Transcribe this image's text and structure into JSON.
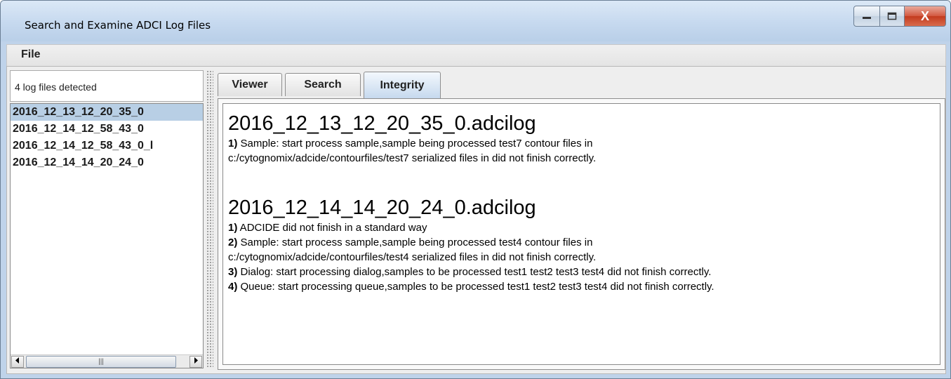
{
  "window": {
    "title": "Search and Examine ADCI Log Files",
    "close_symbol": "X"
  },
  "menubar": {
    "file_label": "File"
  },
  "sidebar": {
    "count_text": "4 log files detected",
    "files": [
      "2016_12_13_12_20_35_0",
      "2016_12_14_12_58_43_0",
      "2016_12_14_12_58_43_0_l",
      "2016_12_14_14_20_24_0"
    ],
    "selected_index": 0,
    "scroll_thumb_grip": "|||"
  },
  "tabs": [
    {
      "label": "Viewer"
    },
    {
      "label": "Search"
    },
    {
      "label": "Integrity"
    }
  ],
  "active_tab": "Integrity",
  "integrity": {
    "reports": [
      {
        "heading": "2016_12_13_12_20_35_0.adcilog",
        "lines": [
          {
            "num": "1)",
            "text": " Sample: start process sample,sample being processed test7 contour files in"
          },
          {
            "num": "",
            "text": "c:/cytognomix/adcide/contourfiles/test7 serialized files in did not finish correctly."
          }
        ]
      },
      {
        "heading": "2016_12_14_14_20_24_0.adcilog",
        "lines": [
          {
            "num": "1)",
            "text": " ADCIDE did not finish in a standard way"
          },
          {
            "num": "2)",
            "text": " Sample: start process sample,sample being processed test4 contour files in"
          },
          {
            "num": "",
            "text": "c:/cytognomix/adcide/contourfiles/test4 serialized files in did not finish correctly."
          },
          {
            "num": "3)",
            "text": " Dialog: start processing dialog,samples to be processed test1 test2 test3 test4 did not finish correctly."
          },
          {
            "num": "4)",
            "text": " Queue: start processing queue,samples to be processed test1 test2 test3 test4 did not finish correctly."
          }
        ]
      }
    ]
  },
  "colors": {
    "selection": "#b8cfe5",
    "titlebar": "#c6d9ef",
    "close_button": "#c33b1e"
  }
}
